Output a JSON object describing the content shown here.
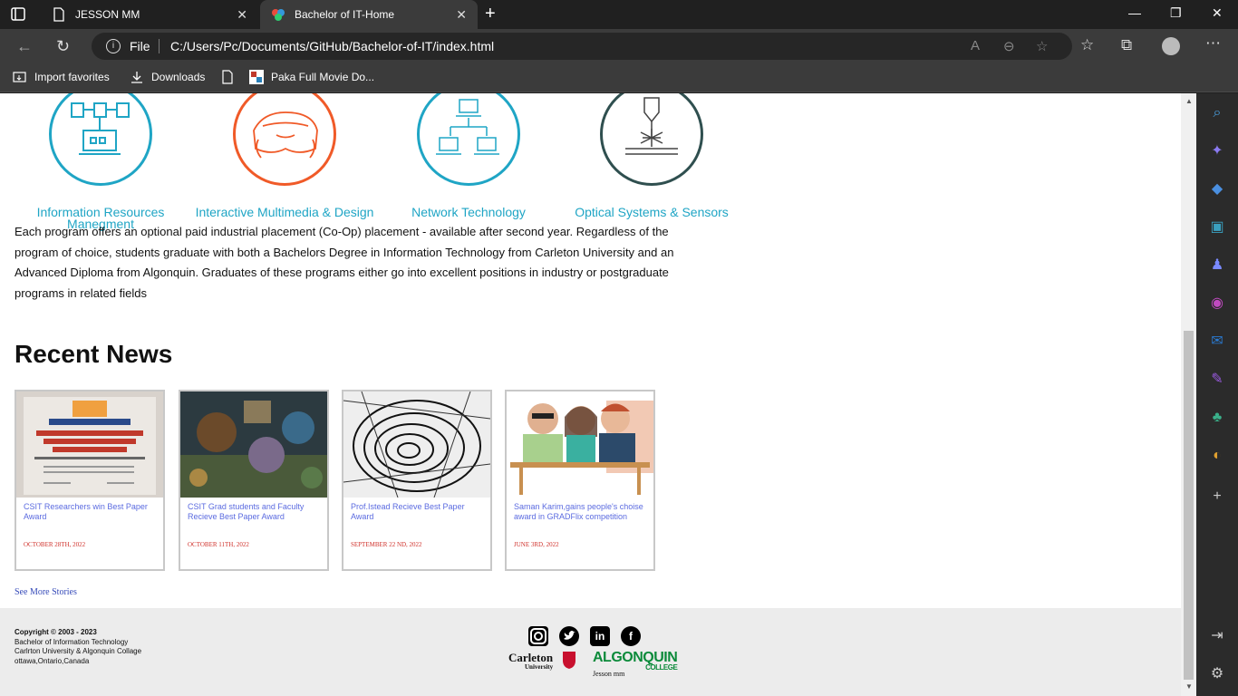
{
  "browser": {
    "tabs": [
      {
        "title": "JESSON MM",
        "active": false
      },
      {
        "title": "Bachelor of IT-Home",
        "active": true
      }
    ],
    "address": {
      "scheme_label": "File",
      "url": "C:/Users/Pc/Documents/GitHub/Bachelor-of-IT/index.html"
    },
    "favorites": [
      {
        "label": "Import favorites"
      },
      {
        "label": "Downloads"
      },
      {
        "label": ""
      },
      {
        "label": "Paka Full Movie Do..."
      }
    ]
  },
  "programs": [
    {
      "label": "Information Resources Manegment",
      "color": "#1fa5c5",
      "icon": "flowchart-icon"
    },
    {
      "label": "Interactive Multimedia & Design",
      "color": "#f05a28",
      "icon": "vr-headset-icon"
    },
    {
      "label": "Network Technology",
      "color": "#1fa5c5",
      "icon": "network-icon"
    },
    {
      "label": "Optical Systems & Sensors",
      "color": "#2f4f4f",
      "icon": "laser-icon"
    }
  ],
  "description": "Each program offers an optional paid industrial placement (Co-Op) placement - available after second year. Regardless of the program of choice, students graduate with both a Bachelors Degree in Information Technology from Carleton University and an Advanced Diploma from Algonquin. Graduates of these programs either go into excellent positions in industry or postgraduate programs in related fields",
  "news": {
    "title": "Recent News",
    "items": [
      {
        "title": "CSIT Researchers win Best Paper Award",
        "date": "October 28th, 2022",
        "image": "best-paper-certificate"
      },
      {
        "title": "CSIT Grad students and Faculty Recieve Best Paper Award",
        "date": "October 11th, 2022",
        "image": "game-scene"
      },
      {
        "title": "Prof.Istead Recieve Best Paper Award",
        "date": "September 22 nd, 2022",
        "image": "swirl-sketch"
      },
      {
        "title": "Saman Karim,gains people's choise award in GRADFlix competition",
        "date": "June 3rd, 2022",
        "image": "cartoon-people"
      }
    ],
    "see_more": "See More Stories"
  },
  "footer": {
    "copyright": "Copyright © 2003 - 2023",
    "line1": "Bachelor of Information Technology",
    "line2": "Carlrton University & Algonquin Collage",
    "line3": "ottawa,Ontario,Canada",
    "social": [
      "instagram-icon",
      "twitter-icon",
      "linkedin-icon",
      "facebook-icon"
    ],
    "carleton": "Carleton",
    "carleton_sub": "University",
    "algonquin": "ALGONQUIN",
    "algonquin_sub": "COLLEGE",
    "author": "Jesson mm"
  }
}
